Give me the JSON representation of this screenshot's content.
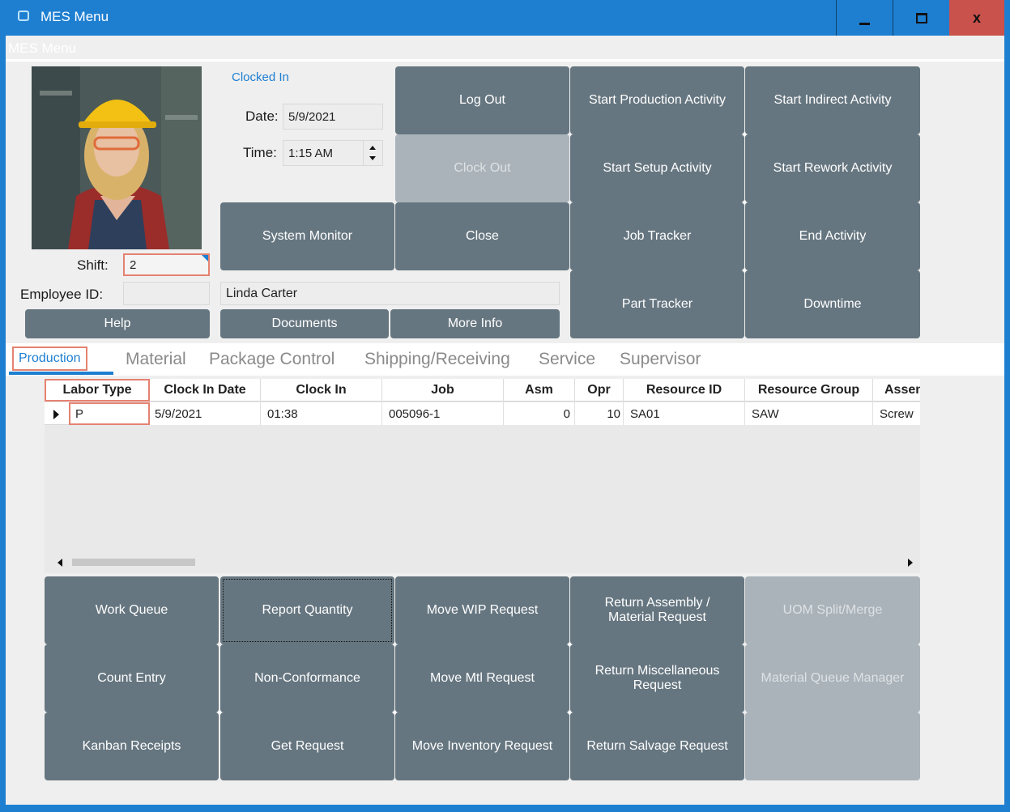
{
  "window": {
    "title": "MES Menu",
    "subtitle": "MES Menu"
  },
  "header": {
    "clocked_status": "Clocked In",
    "date_label": "Date:",
    "date_value": "5/9/2021",
    "time_label": "Time:",
    "time_value": "1:15 AM",
    "shift_label": "Shift:",
    "shift_value": "2",
    "employee_id_label": "Employee ID:",
    "employee_id_value": "",
    "employee_name": "Linda Carter"
  },
  "buttons": {
    "log_out": "Log Out",
    "clock_out": "Clock Out",
    "system_monitor": "System Monitor",
    "close": "Close",
    "help": "Help",
    "documents": "Documents",
    "more_info": "More Info",
    "start_production": "Start Production Activity",
    "start_indirect": "Start Indirect Activity",
    "start_setup": "Start Setup Activity",
    "start_rework": "Start Rework Activity",
    "job_tracker": "Job Tracker",
    "end_activity": "End Activity",
    "part_tracker": "Part Tracker",
    "downtime": "Downtime"
  },
  "tabs": [
    "Production",
    "Material",
    "Package Control",
    "Shipping/Receiving",
    "Service",
    "Supervisor"
  ],
  "grid": {
    "columns": [
      "Labor Type",
      "Clock In Date",
      "Clock In",
      "Job",
      "Asm",
      "Opr",
      "Resource ID",
      "Resource Group",
      "Assen"
    ],
    "rows": [
      [
        "P",
        "5/9/2021",
        "01:38",
        "005096-1",
        "0",
        "10",
        "SA01",
        "SAW",
        "Screw"
      ]
    ]
  },
  "actions": [
    [
      "Work Queue",
      "Report Quantity",
      "Move WIP Request",
      "Return Assembly / Material Request",
      "UOM Split/Merge"
    ],
    [
      "Count Entry",
      "Non-Conformance",
      "Move Mtl Request",
      "Return Miscellaneous Request",
      "Material Queue Manager"
    ],
    [
      "Kanban Receipts",
      "Get Request",
      "Move Inventory Request",
      "Return Salvage Request",
      ""
    ]
  ],
  "colors": {
    "titlebar": "#1e7fd1",
    "tile": "#667680",
    "tile_disabled": "#aab3b9",
    "highlight": "#e58271",
    "close": "#c9524c"
  }
}
